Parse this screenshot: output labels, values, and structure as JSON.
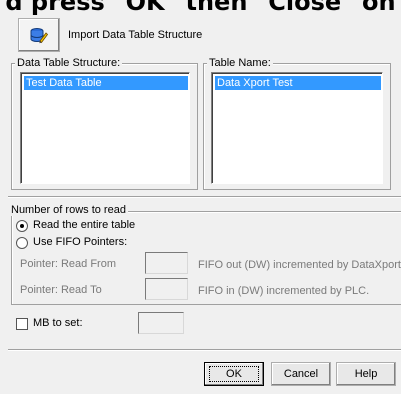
{
  "heading": "d press \"OK\" then \"Close\" on",
  "toolbar": {
    "import_icon": "database-edit-icon",
    "import_label": "Import Data Table Structure"
  },
  "structure_group": {
    "title": "Data Table Structure:",
    "items": [
      "Test Data Table"
    ],
    "selected": "Test Data Table"
  },
  "table_name_group": {
    "title": "Table Name:",
    "items": [
      "Data Xport Test"
    ],
    "selected": "Data Xport Test"
  },
  "rows_group": {
    "title": "Number of rows to read",
    "read_entire_label": "Read the entire table",
    "read_entire_selected": true,
    "use_fifo_label": "Use FIFO Pointers:",
    "use_fifo_selected": false,
    "pointer_read_from_label": "Pointer: Read From",
    "pointer_read_from_value": "",
    "pointer_read_from_hint": "FIFO out (DW) incremented by DataXport.",
    "pointer_read_to_label": "Pointer: Read To",
    "pointer_read_to_value": "",
    "pointer_read_to_hint": "FIFO in (DW) incremented by PLC."
  },
  "mb_to_set": {
    "label": "MB to set:",
    "checked": false,
    "value": ""
  },
  "buttons": {
    "ok": "OK",
    "cancel": "Cancel",
    "help": "Help"
  },
  "colors": {
    "selection": "#3399ff",
    "dialog_bg": "#f0f0f0"
  }
}
